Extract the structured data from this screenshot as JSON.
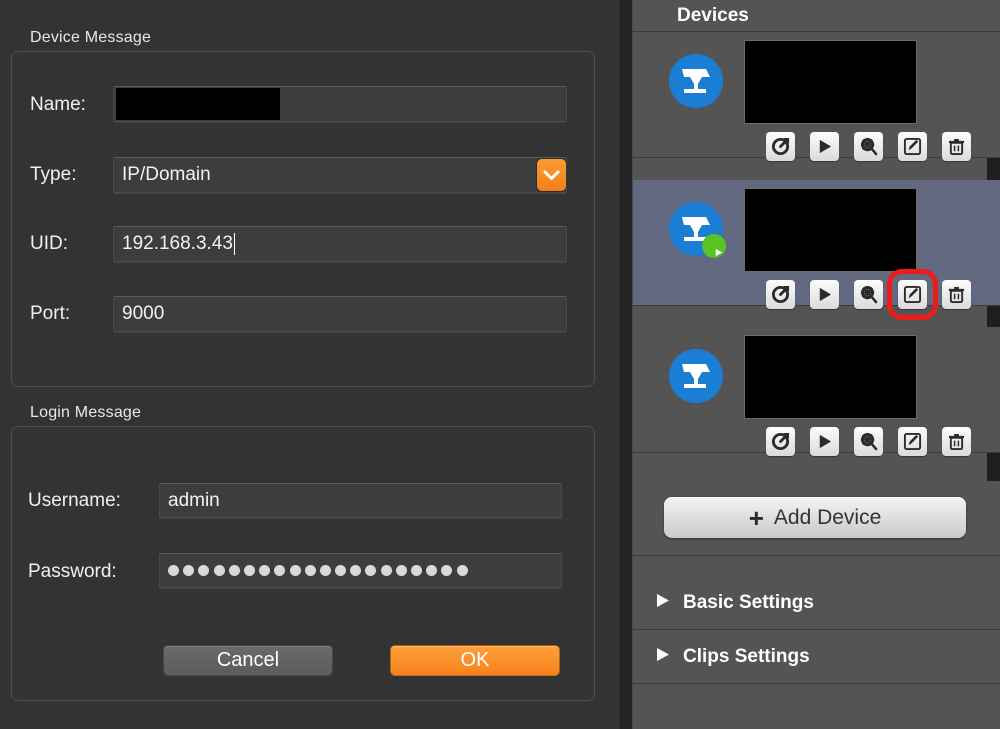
{
  "dialog": {
    "device_group_title": "Device Message",
    "login_group_title": "Login Message",
    "fields": {
      "name_label": "Name:",
      "name_value": "",
      "type_label": "Type:",
      "type_value": "IP/Domain",
      "type_dropdown_icon": "chevron-down-icon",
      "uid_label": "UID:",
      "uid_value": "192.168.3.43",
      "port_label": "Port:",
      "port_value": "9000",
      "username_label": "Username:",
      "username_value": "admin",
      "password_label": "Password:",
      "password_mask_count": 20
    },
    "buttons": {
      "cancel_label": "Cancel",
      "ok_label": "OK"
    },
    "colors": {
      "accent_orange": "#f8821c",
      "dialog_bg": "#333333",
      "field_bg": "#3d3d3d"
    }
  },
  "panel": {
    "header_title": "Devices",
    "device_actions": [
      {
        "name": "refresh-icon",
        "label": "Refresh"
      },
      {
        "name": "play-icon",
        "label": "Play"
      },
      {
        "name": "settings-icon",
        "label": "Settings"
      },
      {
        "name": "edit-icon",
        "label": "Edit"
      },
      {
        "name": "trash-icon",
        "label": "Delete"
      }
    ],
    "devices": [
      {
        "name_redacted": true,
        "selected": false,
        "streaming": false,
        "thumbnail": "black"
      },
      {
        "name_redacted": true,
        "selected": true,
        "streaming": true,
        "thumbnail": "black"
      },
      {
        "name_redacted": true,
        "selected": false,
        "streaming": false,
        "thumbnail": "black"
      }
    ],
    "add_device": {
      "plus": "+",
      "label": "Add Device"
    },
    "settings_sections": [
      {
        "label": "Basic Settings",
        "expanded": false,
        "marker": "triangle-right-icon"
      },
      {
        "label": "Clips Settings",
        "expanded": false,
        "marker": "triangle-right-icon"
      }
    ],
    "highlight": {
      "target": "edit-icon",
      "device_index": 1,
      "color": "#ee1b1b"
    },
    "colors": {
      "panel_bg": "#545454",
      "selected_row_bg": "#61687f",
      "camera_blue": "#1a7fd4",
      "streaming_green": "#58c322"
    }
  }
}
